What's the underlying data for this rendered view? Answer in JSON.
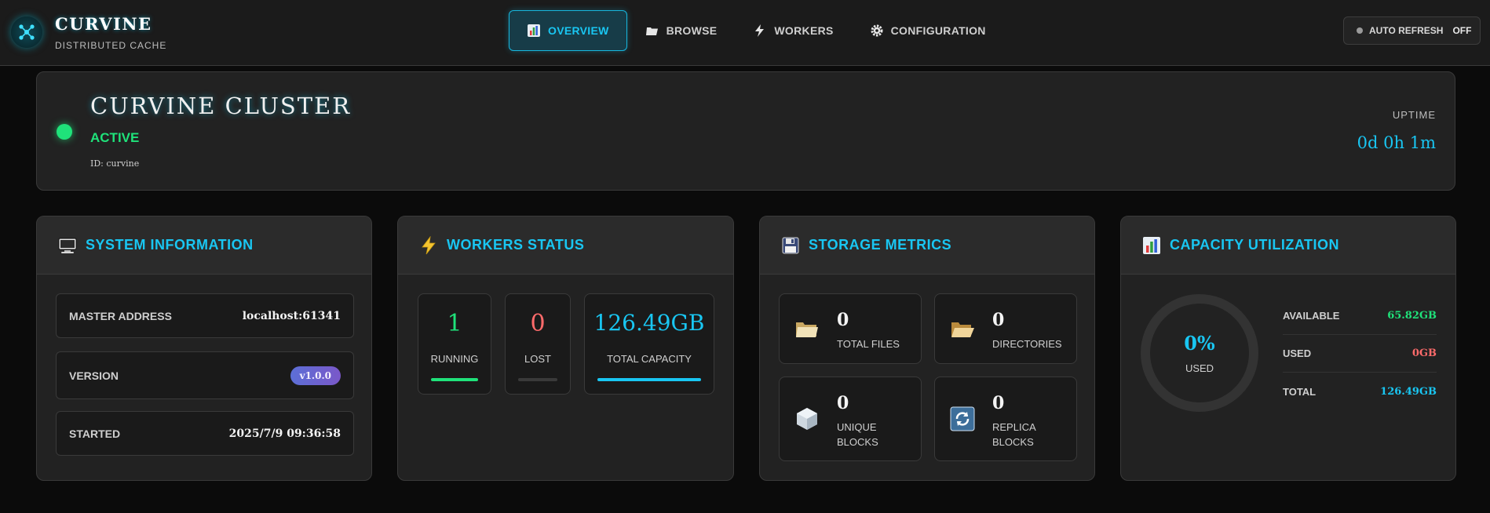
{
  "header": {
    "brand_title": "CURVINE",
    "brand_subtitle": "DISTRIBUTED CACHE",
    "logo_icon": "network-hub-icon",
    "nav": [
      {
        "label": "OVERVIEW",
        "icon": "chart-icon",
        "active": true
      },
      {
        "label": "BROWSE",
        "icon": "folder-icon",
        "active": false
      },
      {
        "label": "WORKERS",
        "icon": "lightning-icon",
        "active": false
      },
      {
        "label": "CONFIGURATION",
        "icon": "gear-icon",
        "active": false
      }
    ],
    "auto_refresh": {
      "label": "AUTO REFRESH",
      "state": "OFF"
    }
  },
  "cluster": {
    "name": "CURVINE CLUSTER",
    "status": "ACTIVE",
    "id_text": "ID: curvine",
    "uptime_label": "UPTIME",
    "uptime_value": "0d 0h 1m"
  },
  "system_info": {
    "title": "SYSTEM INFORMATION",
    "icon": "computer-icon",
    "master_address_label": "MASTER ADDRESS",
    "master_address_value": "localhost:61341",
    "version_label": "VERSION",
    "version_value": "v1.0.0",
    "started_label": "STARTED",
    "started_value": "2025/7/9 09:36:58"
  },
  "workers_status": {
    "title": "WORKERS STATUS",
    "icon": "lightning-icon",
    "running_value": "1",
    "running_label": "RUNNING",
    "lost_value": "0",
    "lost_label": "LOST",
    "capacity_value": "126.49GB",
    "capacity_label": "TOTAL CAPACITY"
  },
  "storage_metrics": {
    "title": "STORAGE METRICS",
    "icon": "floppy-disk-icon",
    "total_files_value": "0",
    "total_files_label": "TOTAL FILES",
    "directories_value": "0",
    "directories_label": "DIRECTORIES",
    "unique_blocks_value": "0",
    "unique_blocks_label": "UNIQUE BLOCKS",
    "replica_blocks_value": "0",
    "replica_blocks_label": "REPLICA BLOCKS"
  },
  "capacity": {
    "title": "CAPACITY UTILIZATION",
    "icon": "chart-icon",
    "used_percent": "0%",
    "used_label": "USED",
    "available_label": "AVAILABLE",
    "available_value": "65.82GB",
    "used_row_label": "USED",
    "used_value": "0GB",
    "total_label": "TOTAL",
    "total_value": "126.49GB"
  },
  "colors": {
    "accent": "#19c6f2",
    "success": "#1fe27a",
    "danger": "#ff6b6b",
    "background": "#0b0b0b",
    "card": "#222222"
  }
}
